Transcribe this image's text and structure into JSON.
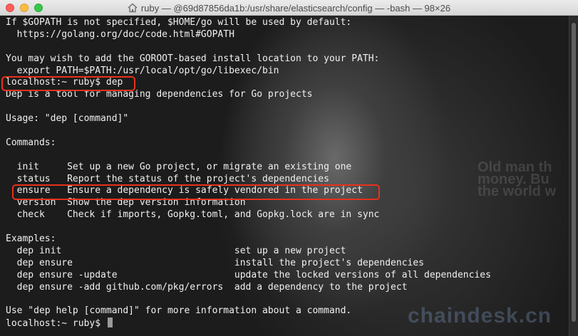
{
  "window": {
    "title": "ruby — @69d87856da1b:/usr/share/elasticsearch/config — -bash — 98×26"
  },
  "terminal": {
    "lines": [
      "If $GOPATH is not specified, $HOME/go will be used by default:",
      "  https://golang.org/doc/code.html#GOPATH",
      "",
      "You may wish to add the GOROOT-based install location to your PATH:",
      "  export PATH=$PATH:/usr/local/opt/go/libexec/bin",
      "localhost:~ ruby$ dep",
      "Dep is a tool for managing dependencies for Go projects",
      "",
      "Usage: \"dep [command]\"",
      "",
      "Commands:",
      "",
      "  init     Set up a new Go project, or migrate an existing one",
      "  status   Report the status of the project's dependencies",
      "  ensure   Ensure a dependency is safely vendored in the project",
      "  version  Show the dep version information",
      "  check    Check if imports, Gopkg.toml, and Gopkg.lock are in sync",
      "",
      "Examples:",
      "  dep init                               set up a new project",
      "  dep ensure                             install the project's dependencies",
      "  dep ensure -update                     update the locked versions of all dependencies",
      "  dep ensure -add github.com/pkg/errors  add a dependency to the project",
      "",
      "Use \"dep help [command]\" for more information about a command.",
      "localhost:~ ruby$ "
    ]
  },
  "background": {
    "overlay_text": "Old man th\nmoney. Bu\nthe world w",
    "watermark": "chaindesk.cn"
  },
  "colors": {
    "highlight_box": "#e8311a",
    "terminal_text": "#f0f0f0"
  }
}
